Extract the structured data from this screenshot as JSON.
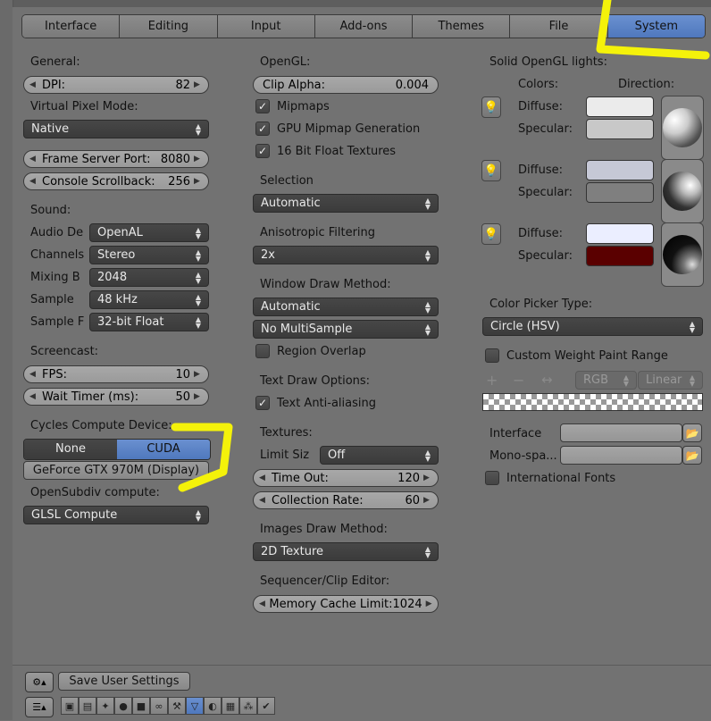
{
  "tabs": [
    {
      "label": "Interface"
    },
    {
      "label": "Editing"
    },
    {
      "label": "Input"
    },
    {
      "label": "Add-ons"
    },
    {
      "label": "Themes"
    },
    {
      "label": "File"
    },
    {
      "label": "System"
    }
  ],
  "active_tab": "System",
  "col1": {
    "general_label": "General:",
    "dpi": {
      "label": "DPI:",
      "value": "82"
    },
    "virtual_pixel_label": "Virtual Pixel Mode:",
    "virtual_pixel_value": "Native",
    "frame_server": {
      "label": "Frame Server Port:",
      "value": "8080"
    },
    "console_scroll": {
      "label": "Console Scrollback:",
      "value": "256"
    },
    "sound_label": "Sound:",
    "audio_device": {
      "label": "Audio De",
      "value": "OpenAL"
    },
    "channels": {
      "label": "Channels",
      "value": "Stereo"
    },
    "mixing": {
      "label": "Mixing B",
      "value": "2048"
    },
    "sample": {
      "label": "Sample",
      "value": "48 kHz"
    },
    "sample_f": {
      "label": "Sample F",
      "value": "32-bit Float"
    },
    "screencast_label": "Screencast:",
    "fps": {
      "label": "FPS:",
      "value": "10"
    },
    "wait_timer": {
      "label": "Wait Timer (ms):",
      "value": "50"
    },
    "cycles_label": "Cycles Compute Device:",
    "cycles_none": "None",
    "cycles_cuda": "CUDA",
    "gpu": "GeForce GTX 970M (Display)",
    "opensubdiv_label": "OpenSubdiv compute:",
    "opensubdiv_value": "GLSL Compute"
  },
  "col2": {
    "opengl_label": "OpenGL:",
    "clip_alpha": {
      "label": "Clip Alpha:",
      "value": "0.004"
    },
    "mipmaps": "Mipmaps",
    "gpu_mipmap": "GPU Mipmap Generation",
    "float_textures": "16 Bit Float Textures",
    "selection_label": "Selection",
    "selection_value": "Automatic",
    "aniso_label": "Anisotropic Filtering",
    "aniso_value": "2x",
    "window_draw_label": "Window Draw Method:",
    "window_draw_value": "Automatic",
    "multisample_value": "No MultiSample",
    "region_overlap": "Region Overlap",
    "text_draw_label": "Text Draw Options:",
    "text_aa": "Text Anti-aliasing",
    "textures_label": "Textures:",
    "limit_size_label": "Limit Siz",
    "limit_size_value": "Off",
    "time_out": {
      "label": "Time Out:",
      "value": "120"
    },
    "collection_rate": {
      "label": "Collection Rate:",
      "value": "60"
    },
    "images_draw_label": "Images Draw Method:",
    "images_draw_value": "2D Texture",
    "sequencer_label": "Sequencer/Clip Editor:",
    "memory_cache": {
      "label": "Memory Cache Limit:",
      "value": "1024"
    }
  },
  "col3": {
    "solid_lights_label": "Solid OpenGL lights:",
    "colors_label": "Colors:",
    "direction_label": "Direction:",
    "diffuse_label": "Diffuse:",
    "specular_label": "Specular:",
    "lights": [
      {
        "diffuse": "#ebebeb",
        "specular": "#c8c8c8"
      },
      {
        "diffuse": "#c6c8d6",
        "specular": "#7f7f7f"
      },
      {
        "diffuse": "#ebeeff",
        "specular": "#5a0000"
      }
    ],
    "color_picker_label": "Color Picker Type:",
    "color_picker_value": "Circle (HSV)",
    "custom_weight": "Custom Weight Paint Range",
    "rgb_value": "RGB",
    "linear_value": "Linear",
    "interface_label": "Interface",
    "mono_label": "Mono-spa...",
    "intl_fonts": "International Fonts"
  },
  "bottom": {
    "save_settings": "Save User Settings"
  }
}
